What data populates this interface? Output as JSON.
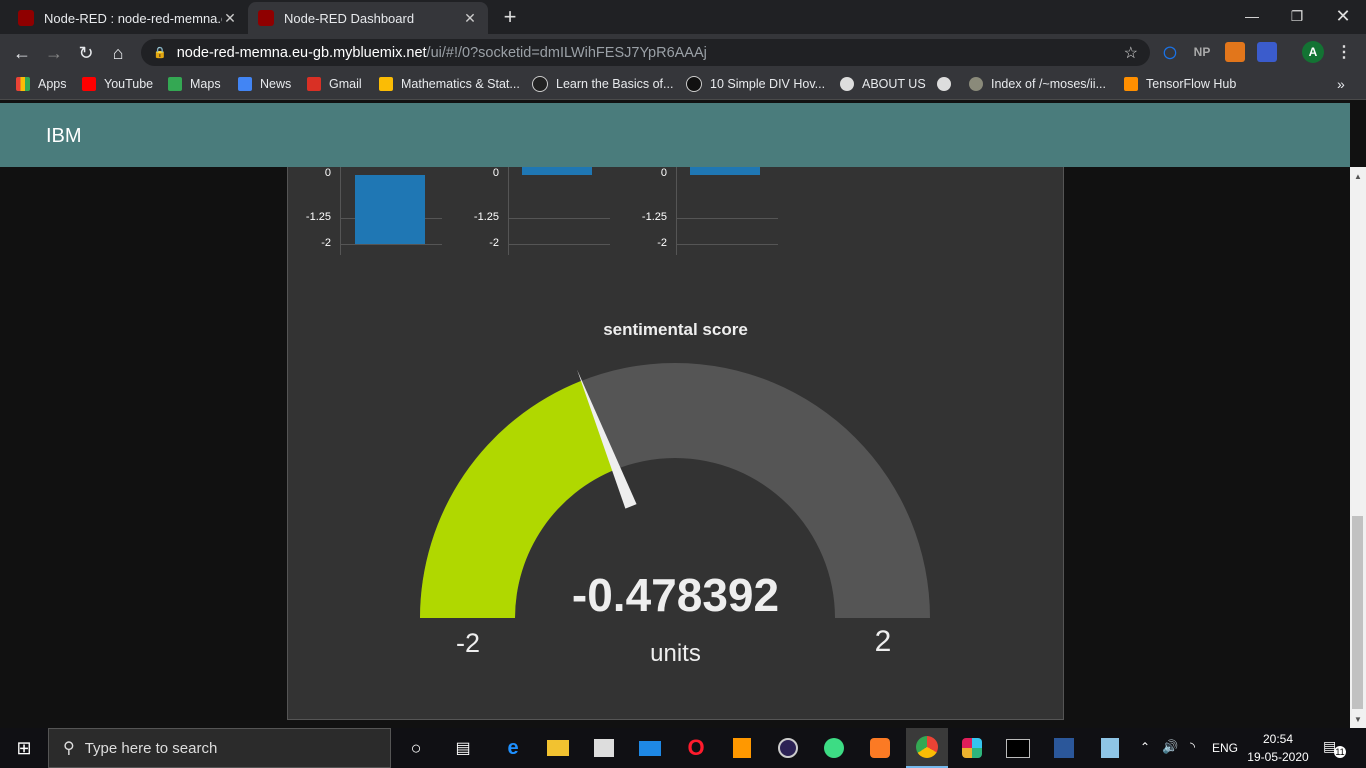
{
  "browser": {
    "tabs": [
      {
        "title": "Node-RED : node-red-memna.eu-gb.mybluemix.net",
        "close": "✕"
      },
      {
        "title": "Node-RED Dashboard",
        "close": "✕"
      }
    ],
    "new_tab": "+",
    "window_controls": {
      "minimize": "—",
      "restore": "❐",
      "close": "✕"
    },
    "url_host": "node-red-memna.eu-gb.mybluemix.net",
    "url_path": "/ui/#!/0?socketid=dmILWihFESJ7YpR6AAAj",
    "extensions": [
      "NP",
      "A"
    ],
    "bookmarks": [
      "Apps",
      "YouTube",
      "Maps",
      "News",
      "Gmail",
      "Mathematics & Stat...",
      "Learn the Basics of...",
      "10 Simple DIV Hov...",
      "ABOUT US",
      "",
      "Index of /~moses/ii...",
      "TensorFlow Hub"
    ],
    "bookmarks_more": "»"
  },
  "dashboard": {
    "title": "IBM",
    "charts": [
      {
        "ticks": [
          "0",
          "-1.25",
          "-2"
        ]
      },
      {
        "ticks": [
          "0",
          "-1.25",
          "-2"
        ]
      },
      {
        "ticks": [
          "0",
          "-1.25",
          "-2"
        ]
      }
    ],
    "gauge": {
      "title": "sentimental score",
      "value": "-0.478392",
      "units": "units",
      "min": "-2",
      "max": "2",
      "fill_color": "#b0d800",
      "track_color": "#555555"
    }
  },
  "chart_data": {
    "type": "bar",
    "ylim": [
      -2,
      0
    ],
    "yticks": [
      "0",
      "-1.25",
      "-2"
    ],
    "series": [
      {
        "values": [
          -2
        ]
      },
      {
        "values": [
          0
        ]
      },
      {
        "values": [
          0
        ]
      }
    ]
  },
  "taskbar": {
    "search_placeholder": "Type here to search",
    "language": "ENG",
    "time": "20:54",
    "date": "19-05-2020",
    "notifications": "11"
  }
}
